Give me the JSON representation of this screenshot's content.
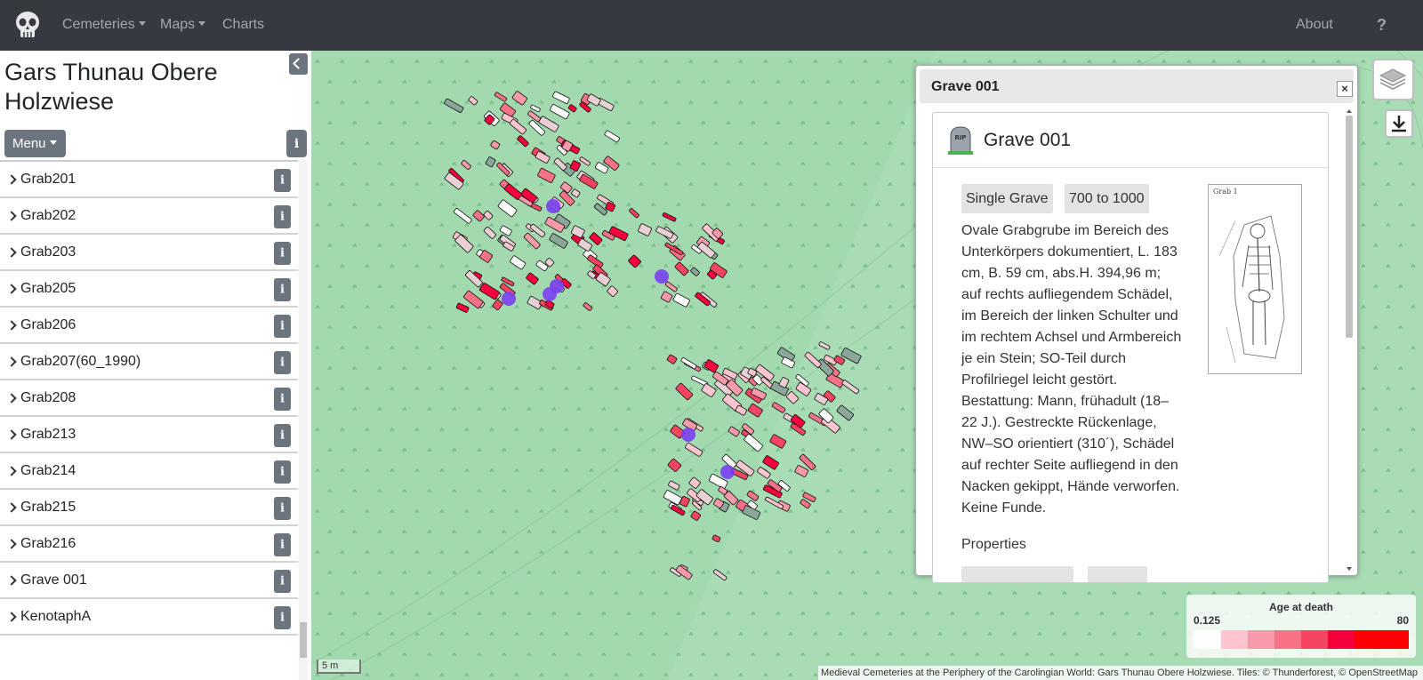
{
  "navbar": {
    "logo_icon": "skull-icon",
    "items": [
      {
        "label": "Cemeteries",
        "dropdown": true
      },
      {
        "label": "Maps",
        "dropdown": true
      },
      {
        "label": "Charts",
        "dropdown": false
      }
    ],
    "about": "About",
    "help": "?"
  },
  "sidebar": {
    "title": "Gars Thunau Obere Holzwiese",
    "menu_label": "Menu",
    "items": [
      {
        "label": "Grab201"
      },
      {
        "label": "Grab202"
      },
      {
        "label": "Grab203"
      },
      {
        "label": "Grab205"
      },
      {
        "label": "Grab206"
      },
      {
        "label": "Grab207(60_1990)"
      },
      {
        "label": "Grab208"
      },
      {
        "label": "Grab213"
      },
      {
        "label": "Grab214"
      },
      {
        "label": "Grab215"
      },
      {
        "label": "Grab216"
      },
      {
        "label": "Grave 001"
      },
      {
        "label": "KenotaphA"
      }
    ]
  },
  "popup": {
    "header_title": "Grave 001",
    "close_label": "×",
    "card_title": "Grave 001",
    "card_icon": "tombstone-rip-icon",
    "badges": [
      "Single Grave",
      "700 to 1000"
    ],
    "description": "Ovale Grabgrube im Bereich des Unterkörpers dokumentiert, L. 183 cm, B. 59 cm, abs.H. 394,96 m; auf rechts aufliegendem Schädel, im Bereich der linken Schulter und im rechtem Achsel und Armbereich je ein Stein; SO-Teil durch Profilriegel leicht gestört. Bestattung: Mann, frühadult (18–22 J.). Gestreckte Rückenlage, NW–SO orientiert (310´), Schädel auf rechter Seite aufliegend in den Nacken gekippt, Hände verworfen. Keine Funde.",
    "properties_label": "Properties",
    "sketch_caption": "Grab 1"
  },
  "legend": {
    "title": "Age at death",
    "min": "0.125",
    "max": "80",
    "colors": [
      "#ffffff",
      "#fcc5cf",
      "#f99aab",
      "#f77287",
      "#f54563",
      "#f5003c",
      "#ff0000"
    ]
  },
  "scale_label": "5 m",
  "attribution": "Medieval Cemeteries at the Periphery of the Carolingian World: Gars Thunau Obere Holzwiese. Tiles: © Thunderforest, © OpenStreetMap",
  "map_controls": {
    "layers_icon": "layers-icon",
    "download_icon": "download-icon"
  }
}
